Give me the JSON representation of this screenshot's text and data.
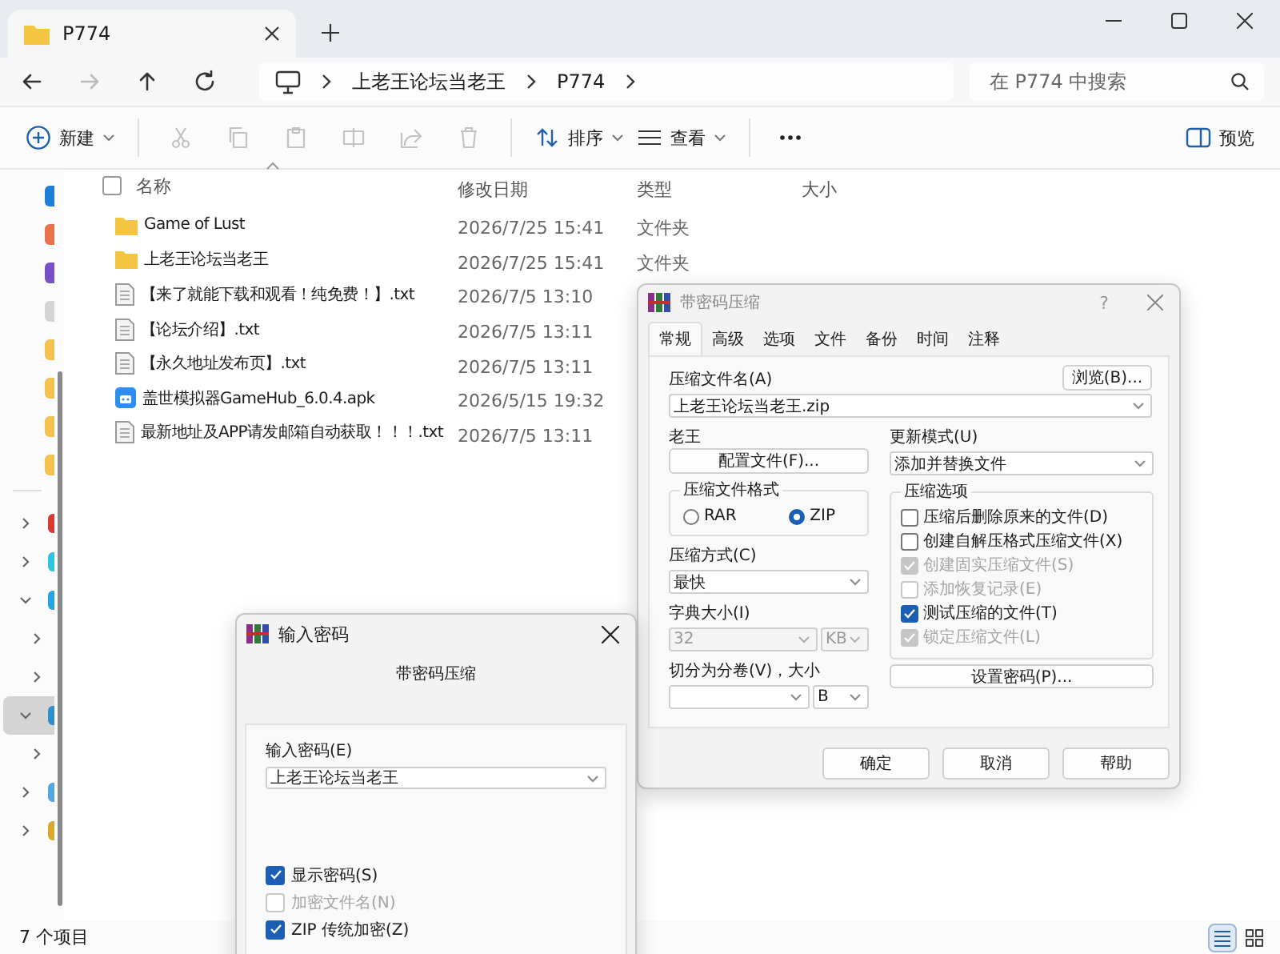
{
  "window": {
    "tab_title": "P774"
  },
  "nav": {
    "buttons": [
      {
        "kind": "back",
        "disabled": false
      },
      {
        "kind": "forward",
        "disabled": true
      },
      {
        "kind": "up",
        "disabled": false
      },
      {
        "kind": "refresh",
        "disabled": false
      }
    ],
    "crumbs": [
      "上老王论坛当老王",
      "P774"
    ],
    "search_placeholder": "在 P774 中搜索"
  },
  "toolbar": {
    "new_label": "新建",
    "edit_actions": [
      {
        "kind": "cut",
        "disabled": true
      },
      {
        "kind": "copy",
        "disabled": true
      },
      {
        "kind": "paste",
        "disabled": true
      },
      {
        "kind": "rename",
        "disabled": true
      },
      {
        "kind": "share",
        "disabled": true
      },
      {
        "kind": "delete",
        "disabled": true
      }
    ],
    "sort_label": "排序",
    "view_label": "查看",
    "preview_label": "预览"
  },
  "sidebar": {
    "pinned": [
      {
        "color": "#1f7fd8"
      },
      {
        "color": "#e8734a"
      },
      {
        "color": "#7a50c8"
      },
      {
        "color": "#d4d4d4"
      },
      {
        "color": "#f2c14e"
      },
      {
        "color": "#f2c14e"
      },
      {
        "color": "#f2c14e"
      },
      {
        "color": "#f2c14e"
      }
    ],
    "tree": [
      {
        "color": "#d83a34",
        "expanded": false,
        "selected": false
      },
      {
        "color": "#2ec4dc",
        "expanded": false,
        "selected": false
      },
      {
        "color": "#25a4e6",
        "expanded": true,
        "selected": false,
        "children": [
          {
            "expanded": false,
            "selected": false
          },
          {
            "expanded": false,
            "selected": false
          }
        ]
      },
      {
        "color": "#2a90d0",
        "expanded": true,
        "selected": true,
        "children": [
          {
            "expanded": false,
            "selected": false
          }
        ]
      },
      {
        "color": "#55a6e0",
        "expanded": false,
        "selected": false
      },
      {
        "color": "#d8a92c",
        "expanded": false,
        "selected": false
      }
    ]
  },
  "table": {
    "select_all_checked": false,
    "columns": [
      "名称",
      "修改日期",
      "类型",
      "大小"
    ],
    "rows": [
      {
        "kind": "folder",
        "name": "Game of Lust",
        "date": "2026/7/25 15:41",
        "type": "文件夹"
      },
      {
        "kind": "folder",
        "name": "上老王论坛当老王",
        "date": "2026/7/25 15:41",
        "type": "文件夹"
      },
      {
        "kind": "text",
        "name": "【来了就能下载和观看！纯免费！】.txt",
        "date": "2026/7/5 13:10"
      },
      {
        "kind": "text",
        "name": "【论坛介绍】.txt",
        "date": "2026/7/5 13:11"
      },
      {
        "kind": "text",
        "name": "【永久地址发布页】.txt",
        "date": "2026/7/5 13:11"
      },
      {
        "kind": "app",
        "name": "盖世模拟器GameHub_6.0.4.apk",
        "date": "2026/5/15 19:32"
      },
      {
        "kind": "text",
        "name": "最新地址及APP请发邮箱自动获取！！！.txt",
        "date": "2026/7/5 13:11"
      }
    ]
  },
  "status_bar": {
    "count": "7 个项目",
    "views": [
      {
        "kind": "details",
        "selected": true
      },
      {
        "kind": "tiles",
        "selected": false
      }
    ]
  },
  "archive_dialog": {
    "title": "带密码压缩",
    "active": false,
    "help_glyph": "?",
    "tabs": [
      {
        "label": "常规",
        "selected": true
      },
      {
        "label": "高级",
        "selected": false
      },
      {
        "label": "选项",
        "selected": false
      },
      {
        "label": "文件",
        "selected": false
      },
      {
        "label": "备份",
        "selected": false
      },
      {
        "label": "时间",
        "selected": false
      },
      {
        "label": "注释",
        "selected": false
      }
    ],
    "archive_name_label": "压缩文件名(A)",
    "browse_button": "浏览(B)...",
    "archive_name": "上老王论坛当老王.zip",
    "profile_label": "老王",
    "profile_button": "配置文件(F)...",
    "update_label": "更新模式(U)",
    "update_mode": "添加并替换文件",
    "format_label": "压缩文件格式",
    "formats": [
      {
        "label": "RAR",
        "selected": false
      },
      {
        "label": "ZIP",
        "selected": true
      }
    ],
    "method_label": "压缩方式(C)",
    "method": "最快",
    "dict_label": "字典大小(I)",
    "dict_size": "32",
    "dict_unit": "KB",
    "dict_disabled": true,
    "split_label": "切分为分卷(V)，大小",
    "split_unit": "B",
    "options_label": "压缩选项",
    "options": [
      {
        "label": "压缩后删除原来的文件(D)",
        "checked": false,
        "disabled": false
      },
      {
        "label": "创建自解压格式压缩文件(X)",
        "checked": false,
        "disabled": false
      },
      {
        "label": "创建固实压缩文件(S)",
        "checked": true,
        "disabled": true
      },
      {
        "label": "添加恢复记录(E)",
        "checked": false,
        "disabled": true
      },
      {
        "label": "测试压缩的文件(T)",
        "checked": true,
        "disabled": false
      },
      {
        "label": "锁定压缩文件(L)",
        "checked": true,
        "disabled": true
      }
    ],
    "password_button": "设置密码(P)...",
    "buttons": [
      "确定",
      "取消",
      "帮助"
    ]
  },
  "password_dialog": {
    "title": "输入密码",
    "active": true,
    "heading": "带密码压缩",
    "password_label": "输入密码(E)",
    "password": "上老王论坛当老王",
    "options": [
      {
        "label": "显示密码(S)",
        "checked": true,
        "disabled": false
      },
      {
        "label": "加密文件名(N)",
        "checked": false,
        "disabled": true
      },
      {
        "label": "ZIP 传统加密(Z)",
        "checked": true,
        "disabled": false
      }
    ]
  }
}
